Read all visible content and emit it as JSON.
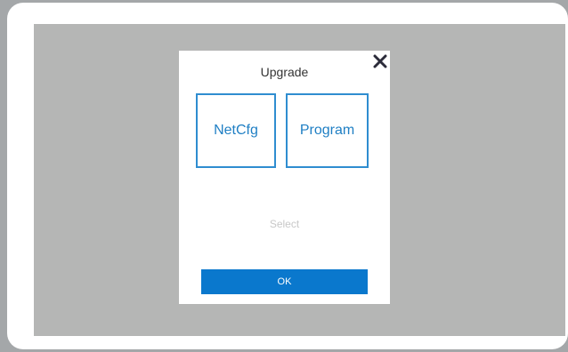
{
  "dialog": {
    "title": "Upgrade",
    "close_icon": "close-icon",
    "options": [
      {
        "label": "NetCfg"
      },
      {
        "label": "Program"
      }
    ],
    "status_text": "Select",
    "ok_label": "OK"
  },
  "colors": {
    "accent": "#0a78cd",
    "option_border": "#2f8dd0",
    "overlay": "#b5b6b5",
    "status_text": "#c8c8c8"
  }
}
